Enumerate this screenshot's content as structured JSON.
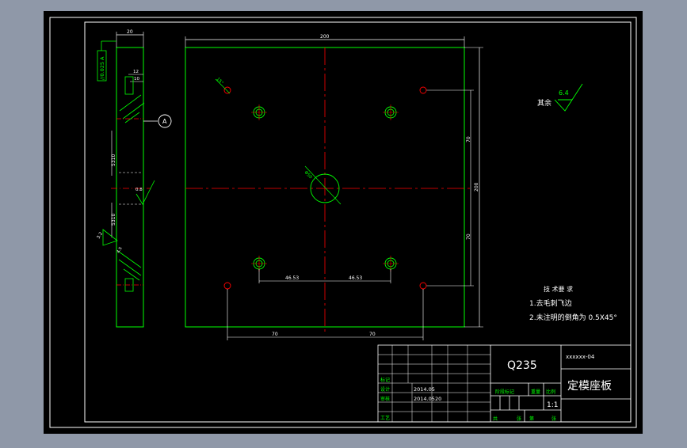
{
  "colors": {
    "background": "#8f98a8",
    "canvas": "#000000",
    "line": "#ffffff",
    "part": "#00ff00",
    "center": "#ff0000",
    "text": "#ffffff"
  },
  "side_view": {
    "dim_top": "20",
    "tolerance_box": "//0.025 A",
    "dim_12": "12",
    "dim_10": "10",
    "datum_label": "A",
    "thread_upper": "5310",
    "thread_lower": "5310",
    "roughness_mid": "0.8",
    "roughness_side": "3.2",
    "small_note": "4.5"
  },
  "front_view": {
    "dim_width": "200",
    "dim_height": "200",
    "dim_70_upper": "70",
    "dim_70_lower": "70",
    "dim_hole_left": "46.53",
    "dim_hole_right": "46.53",
    "dim_bottom_left": "70",
    "dim_bottom_right": "70",
    "center_hole_label": "Φ50",
    "angle_label": "15°"
  },
  "notes": {
    "roughness_other_label": "其余",
    "roughness_other_value": "6.4",
    "tech_title": "技 术要 求",
    "tech_1": "1.去毛刺飞边",
    "tech_2": "2.未注明的倒角为 0.5X45°"
  },
  "title_block": {
    "material": "Q235",
    "part_name": "定模座板",
    "drawing_code": "xxxxxx-04",
    "scale": "1:1",
    "date1": "2014.05",
    "date2": "2014.05",
    "date2b": "20",
    "row_labels": [
      "标记",
      "设计",
      "审核",
      "工艺"
    ],
    "small_headers": [
      "阶段标记",
      "重量",
      "比例"
    ],
    "sheet_labels": [
      "共",
      "张",
      "第",
      "张"
    ]
  }
}
